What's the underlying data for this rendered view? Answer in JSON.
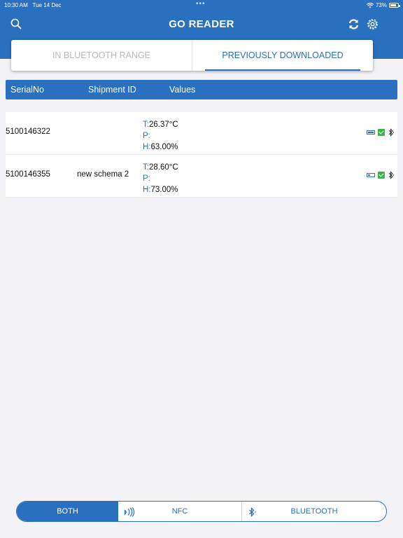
{
  "status_bar": {
    "time": "10:30 AM",
    "date": "Tue 14 Dec",
    "dots": "•••",
    "battery": "73%"
  },
  "header": {
    "title": "GO READER"
  },
  "tabs": [
    {
      "label": "IN BLUETOOTH RANGE",
      "active": false
    },
    {
      "label": "PREVIOUSLY DOWNLOADED",
      "active": true
    }
  ],
  "table": {
    "headers": [
      "SerialNo",
      "Shipment ID",
      "Values"
    ],
    "rows": [
      {
        "serial": "5100146322",
        "shipment": "",
        "t_label": "T:",
        "t": "26.37°C",
        "p_label": "P:",
        "p": "",
        "h_label": "H:",
        "h": "63.00%",
        "battery_level": 1.0
      },
      {
        "serial": "5100146355",
        "shipment": "new schema 2",
        "t_label": "T:",
        "t": "28.60°C",
        "p_label": "P:",
        "p": "",
        "h_label": "H:",
        "h": "73.00%",
        "battery_level": 0.4
      }
    ]
  },
  "bottom_filter": {
    "both": "BOTH",
    "nfc": "NFC",
    "bluetooth": "BLUETOOTH",
    "selected": "BOTH"
  },
  "colors": {
    "accent": "#2a70bf",
    "check": "#3cb44b",
    "background": "#f2f2f7"
  },
  "icons": [
    "search-icon",
    "refresh-icon",
    "settings-icon",
    "battery-icon",
    "check-icon",
    "bluetooth-icon",
    "nfc-icon",
    "wifi-icon"
  ]
}
